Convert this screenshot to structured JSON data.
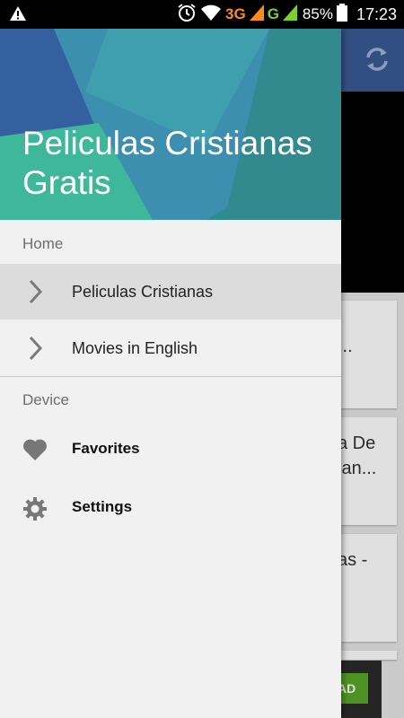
{
  "status_bar": {
    "network_3g": "3G",
    "network_g": "G",
    "battery": "85%",
    "time": "17:23",
    "icons": [
      "warning-icon",
      "alarm-icon",
      "wifi-icon",
      "signal-icon",
      "battery-icon"
    ]
  },
  "drawer": {
    "title": "Peliculas Cristianas Gratis",
    "section_home": "Home",
    "home_items": [
      {
        "label": "Peliculas Cristianas",
        "selected": true
      },
      {
        "label": "Movies in English",
        "selected": false
      }
    ],
    "section_device": "Device",
    "device_items": [
      {
        "label": "Favorites",
        "icon": "heart-icon"
      },
      {
        "label": "Settings",
        "icon": "gear-icon"
      }
    ]
  },
  "background": {
    "card_fragments": [
      "...",
      "a De",
      "ian...",
      "as -"
    ],
    "ad_label": "AD"
  },
  "colors": {
    "app_bar": "#3a5b96",
    "drawer_bg": "#f1f1f1",
    "selected_item": "#dcdcdc",
    "header_teal": "#2a8f92"
  }
}
